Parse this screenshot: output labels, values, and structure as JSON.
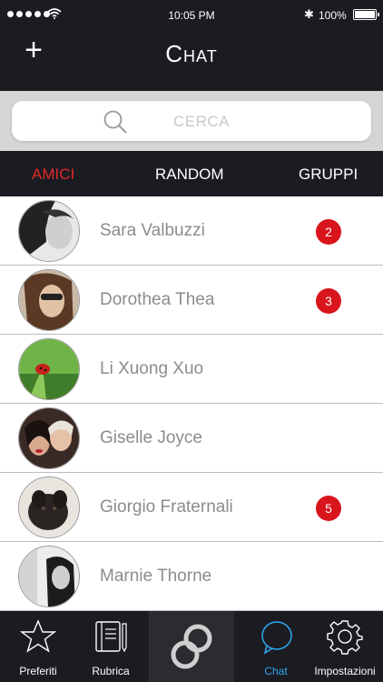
{
  "status_bar": {
    "time": "10:05 PM",
    "battery": "100%",
    "bluetooth_glyph": "✱"
  },
  "nav": {
    "title": "Chat",
    "add_glyph": "+"
  },
  "search": {
    "placeholder": "CERCA"
  },
  "tabs": [
    {
      "label": "AMICI",
      "active": true
    },
    {
      "label": "RANDOM",
      "active": false
    },
    {
      "label": "GRUPPI",
      "active": false
    }
  ],
  "contacts": [
    {
      "name": "Sara Valbuzzi",
      "badge": "2"
    },
    {
      "name": "Dorothea Thea",
      "badge": "3"
    },
    {
      "name": "Li Xuong Xuo",
      "badge": ""
    },
    {
      "name": "Giselle Joyce",
      "badge": ""
    },
    {
      "name": "Giorgio Fraternali",
      "badge": "5"
    },
    {
      "name": "Marnie Thorne",
      "badge": ""
    }
  ],
  "tabbar": {
    "preferiti": "Preferiti",
    "rubrica": "Rubrica",
    "chat": "Chat",
    "impostazioni": "Impostazioni"
  },
  "colors": {
    "dark": "#1b1b22",
    "accent_red": "#e02a2a",
    "badge_red": "#d8141c",
    "selected_blue": "#2ea8f0"
  }
}
